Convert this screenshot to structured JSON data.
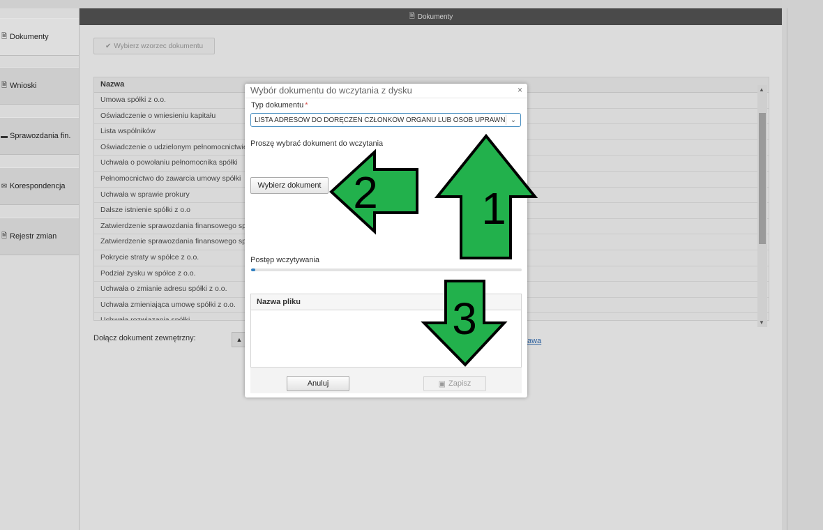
{
  "sidebar": {
    "items": [
      {
        "label": "Dokumenty",
        "icon": "file-icon"
      },
      {
        "label": "Wnioski",
        "icon": "file-icon"
      },
      {
        "label": "Sprawozdania fin.",
        "icon": "folder-open-icon"
      },
      {
        "label": "Korespondencja",
        "icon": "envelope-icon"
      },
      {
        "label": "Rejestr zmian",
        "icon": "file-icon"
      }
    ]
  },
  "panel": {
    "title": "Dokumenty",
    "template_button": "Wybierz wzorzec dokumentu",
    "table": {
      "header": "Nazwa",
      "rows": [
        "Umowa spółki z o.o.",
        "Oświadczenie o wniesieniu kapitału",
        "Lista wspólników",
        "Oświadczenie o udzielonym pełnomocnictwie",
        "Uchwała o powołaniu pełnomocnika spółki",
        "Pełnomocnictwo do zawarcia umowy spółki",
        "Uchwała w sprawie prokury",
        "Dalsze istnienie spółki z o.o",
        "Zatwierdzenie sprawozdania finansowego spółki",
        "Zatwierdzenie sprawozdania finansowego spółki",
        "Pokrycie straty w spółce z o.o.",
        "Podział zysku w spółce z o.o.",
        "Uchwała o zmianie adresu spółki z o.o.",
        "Uchwała zmieniająca umowę spółki z o.o.",
        "Uchwała rozwiązania spółki"
      ]
    },
    "external_label": "Dołącz dokument zewnętrzny:",
    "external_link": "awa"
  },
  "modal": {
    "title": "Wybór dokumentu do wczytania z dysku",
    "close": "×",
    "type_label": "Typ dokumentu",
    "required_mark": "*",
    "type_value": "LISTA ADRESÓW  DO  DORĘCZEŃ  CZŁONKÓW ORGANU LUB OSÓB  UPRAWNIONYCH",
    "prompt": "Proszę wybrać dokument do wczytania",
    "choose_button": "Wybierz dokument",
    "progress_label": "Postęp wczytywania",
    "progress_value": 0.015,
    "files_header": "Nazwa pliku",
    "cancel_button": "Anuluj",
    "save_button": "Zapisz"
  },
  "annotations": {
    "arrow_1": "1",
    "arrow_2": "2",
    "arrow_3": "3",
    "color": "#22b14c"
  }
}
